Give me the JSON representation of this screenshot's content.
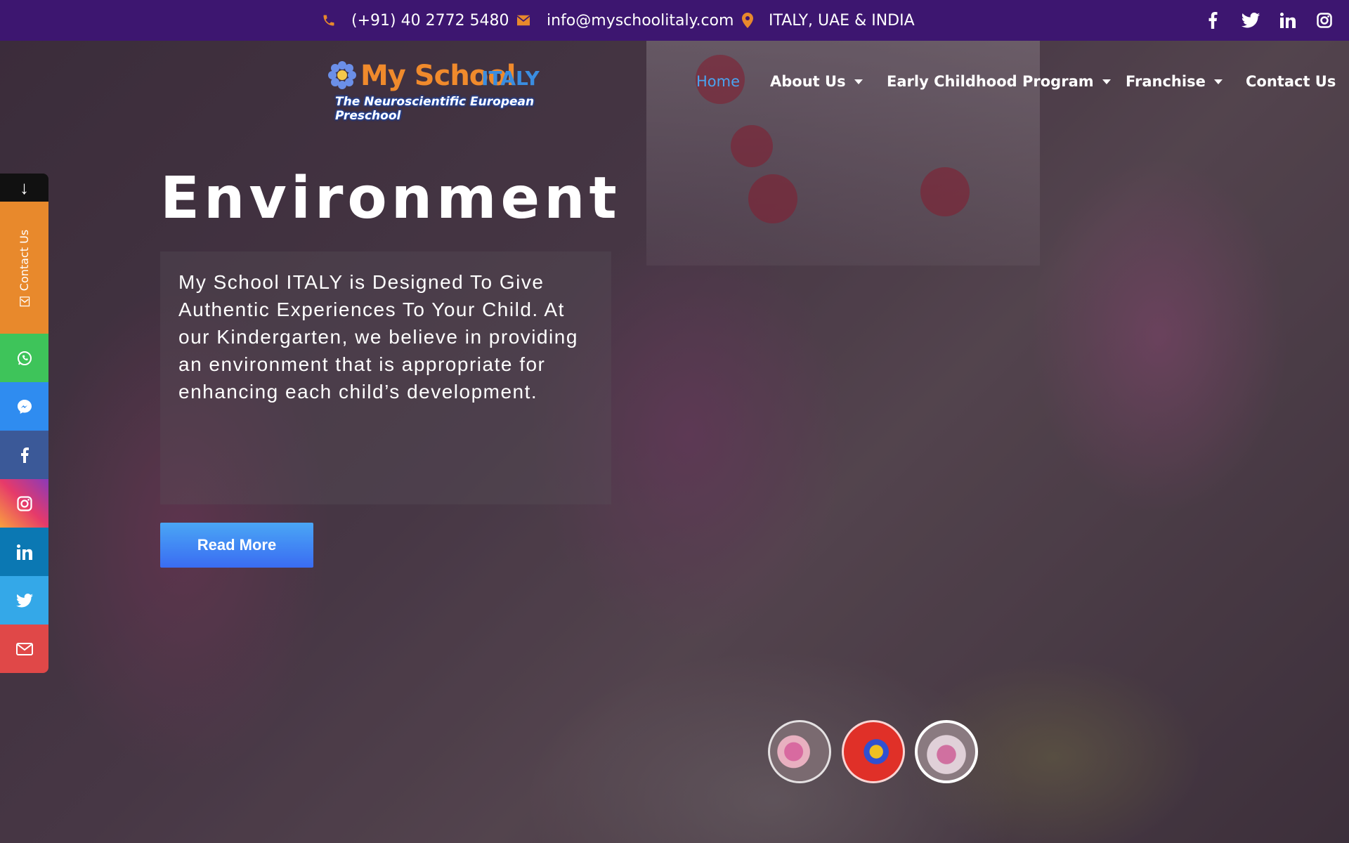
{
  "topbar": {
    "phone": "(+91) 40 2772 5480",
    "email": "info@myschoolitaly.com",
    "location": "ITALY, UAE & INDIA",
    "icons": [
      "phone-icon",
      "envelope-icon",
      "map-marker-icon",
      "facebook-icon",
      "twitter-icon",
      "linkedin-icon",
      "instagram-icon"
    ]
  },
  "header": {
    "logo_main": "My School",
    "logo_italy": "ITALY",
    "logo_tagline": "The Neuroscientific European Preschool",
    "nav": [
      {
        "label": "Home",
        "active": true
      },
      {
        "label": "About Us",
        "dropdown": true
      },
      {
        "label": "Early Childhood Program",
        "dropdown": true
      },
      {
        "label": "Franchise",
        "dropdown": true
      },
      {
        "label": "Contact Us"
      }
    ]
  },
  "hero": {
    "title": "Environment",
    "text": "My School ITALY is Designed To Give Authentic Experiences To Your Child. At our Kindergarten, we believe in providing an environment that is appropriate for enhancing each child’s development.",
    "cta": "Read More"
  },
  "side_bar": {
    "contact_label": "Contact Us",
    "buttons": [
      "whatsapp-icon",
      "messenger-icon",
      "facebook-icon",
      "instagram-icon",
      "linkedin-icon",
      "twitter-icon",
      "mail-icon"
    ]
  },
  "colors": {
    "topbar": "#3d1670",
    "accent_orange": "#e8892c",
    "nav_active": "#4aa3ef",
    "cta_blue": "#3a6cf2"
  }
}
